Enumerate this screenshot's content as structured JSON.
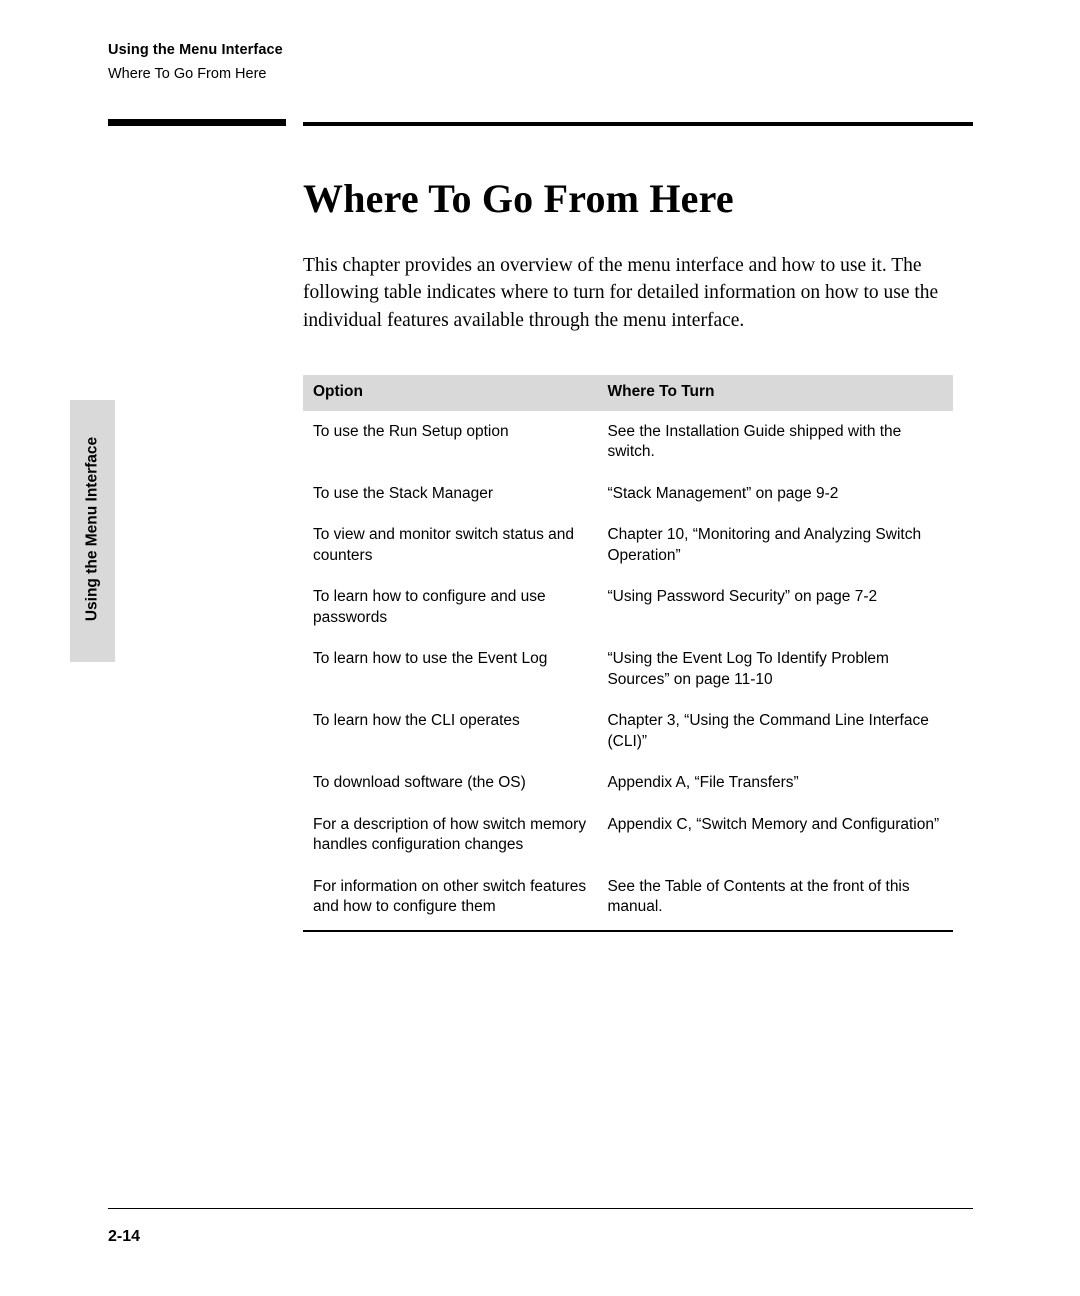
{
  "header": {
    "chapter": "Using the Menu Interface",
    "section": "Where To Go From Here"
  },
  "title": "Where To Go From Here",
  "intro": "This chapter provides an overview of the menu interface and how to use it. The following table indicates where to turn for detailed information on how to use the individual features available through the menu interface.",
  "side_tab": "Using the Menu Interface",
  "table": {
    "headers": [
      "Option",
      "Where To Turn"
    ],
    "rows": [
      {
        "option": "To use the Run Setup option",
        "where": "See the Installation Guide shipped with the switch."
      },
      {
        "option": "To use the Stack Manager",
        "where": "“Stack Management” on page 9-2"
      },
      {
        "option": "To view and monitor switch status and counters",
        "where": "Chapter 10, “Monitoring and Analyzing Switch Operation”"
      },
      {
        "option": "To learn how to configure and use passwords",
        "where": "“Using Password Security” on page 7-2"
      },
      {
        "option": "To learn how to use the Event Log",
        "where": "“Using the Event Log To Identify Problem Sources” on page 11-10"
      },
      {
        "option": "To learn how the CLI operates",
        "where": "Chapter 3, “Using the Command Line Interface (CLI)”"
      },
      {
        "option": "To download software (the OS)",
        "where": "Appendix A, “File Transfers”"
      },
      {
        "option": "For a description of how switch memory handles configuration changes",
        "where": "Appendix C, “Switch Memory and Configuration”"
      },
      {
        "option": "For information on other switch features and how to configure them",
        "where": "See the Table of Contents at the front of this manual."
      }
    ]
  },
  "footer": {
    "page_number": "2-14"
  }
}
